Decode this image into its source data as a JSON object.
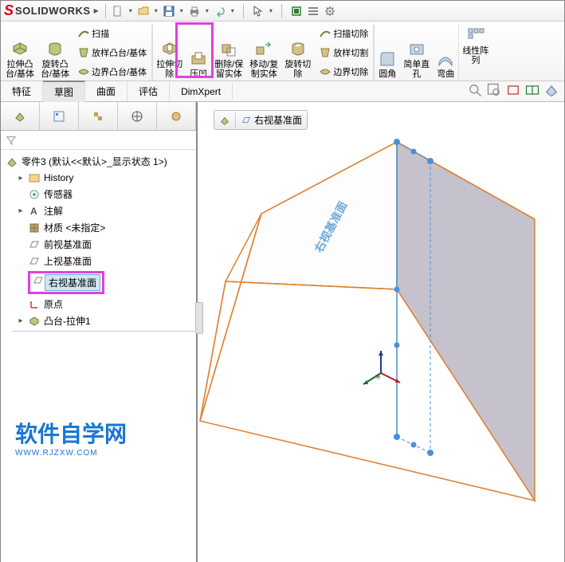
{
  "app": {
    "logo_text": "SOLIDWORKS"
  },
  "ribbon": {
    "extrude_boss": "拉伸凸\n台/基体",
    "revolve_boss": "旋转凸\n台/基体",
    "sweep": "扫描",
    "loft_boss": "放样凸台/基体",
    "boundary_boss": "边界凸台/基体",
    "extrude_cut": "拉伸切\n除",
    "indent": "压凹",
    "delete_keep": "删除/保\n留实体",
    "move_copy": "移动/复\n制实体",
    "revolve_cut": "旋转切\n除",
    "swept_cut": "扫描切除",
    "loft_cut": "放样切割",
    "boundary_cut": "边界切除",
    "fillet": "圆角",
    "hole": "简单直\n孔",
    "bend": "弯曲",
    "pattern": "线性阵\n列"
  },
  "tabs": {
    "feature": "特征",
    "sketch": "草图",
    "surface": "曲面",
    "evaluate": "评估",
    "dimxpert": "DimXpert"
  },
  "plane_crumb": {
    "label": "右视基准面"
  },
  "tree": {
    "root": "零件3 (默认<<默认>_显示状态 1>)",
    "history": "History",
    "sensors": "传感器",
    "annotations": "注解",
    "material": "材质 <未指定>",
    "front_plane": "前视基准面",
    "top_plane": "上视基准面",
    "right_plane": "右视基准面",
    "origin": "原点",
    "boss_extrude": "凸台-拉伸1"
  },
  "viewport": {
    "plane_label": "右视基准面"
  },
  "watermark": {
    "cn": "软件自学网",
    "url": "WWW.RJZXW.COM"
  }
}
